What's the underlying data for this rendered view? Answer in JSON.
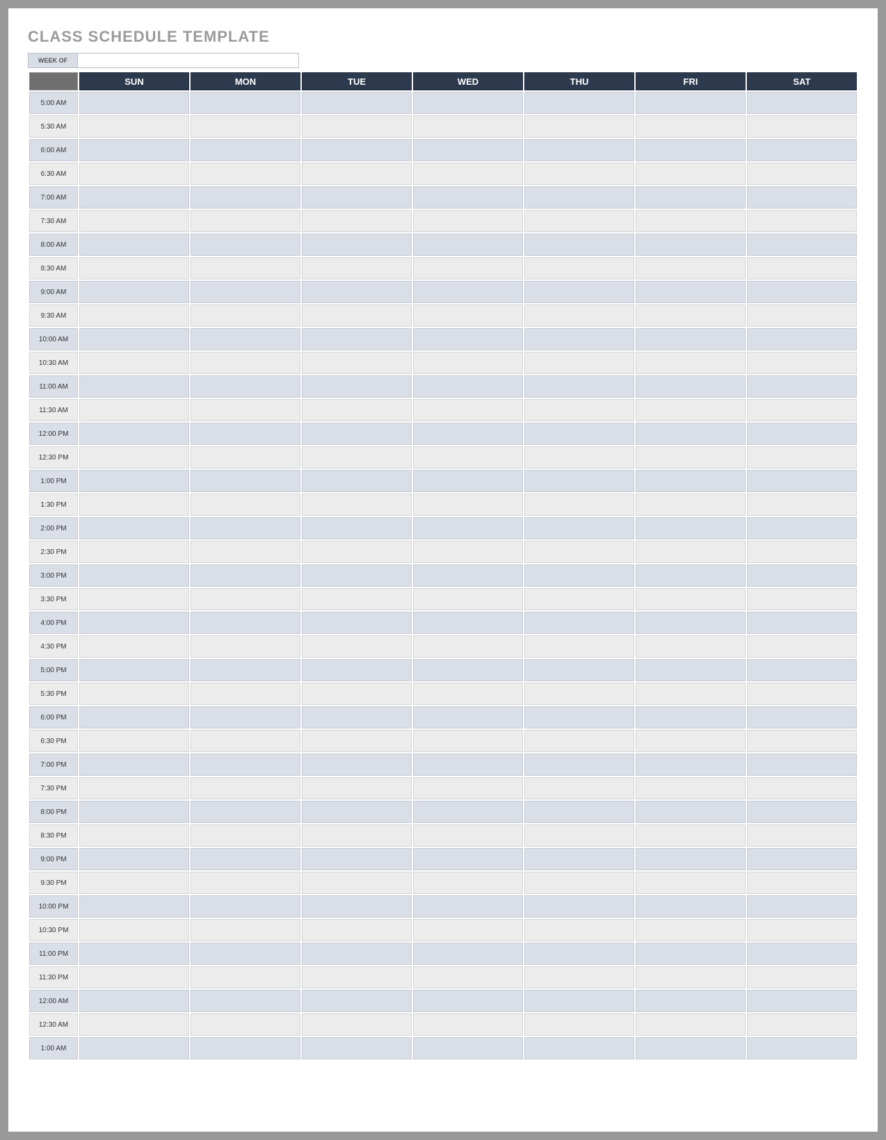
{
  "title": "CLASS SCHEDULE TEMPLATE",
  "week_of_label": "WEEK OF",
  "week_of_value": "",
  "days": [
    "SUN",
    "MON",
    "TUE",
    "WED",
    "THU",
    "FRI",
    "SAT"
  ],
  "times": [
    "5:00 AM",
    "5:30 AM",
    "6:00 AM",
    "6:30 AM",
    "7:00 AM",
    "7:30 AM",
    "8:00 AM",
    "8:30 AM",
    "9:00 AM",
    "9:30 AM",
    "10:00 AM",
    "10:30 AM",
    "11:00 AM",
    "11:30 AM",
    "12:00 PM",
    "12:30 PM",
    "1:00 PM",
    "1:30 PM",
    "2:00 PM",
    "2:30 PM",
    "3:00 PM",
    "3:30 PM",
    "4:00 PM",
    "4:30 PM",
    "5:00 PM",
    "5:30 PM",
    "6:00 PM",
    "6:30 PM",
    "7:00 PM",
    "7:30 PM",
    "8:00 PM",
    "8:30 PM",
    "9:00 PM",
    "9:30 PM",
    "10:00 PM",
    "10:30 PM",
    "11:00 PM",
    "11:30 PM",
    "12:00 AM",
    "12:30 AM",
    "1:00 AM"
  ]
}
